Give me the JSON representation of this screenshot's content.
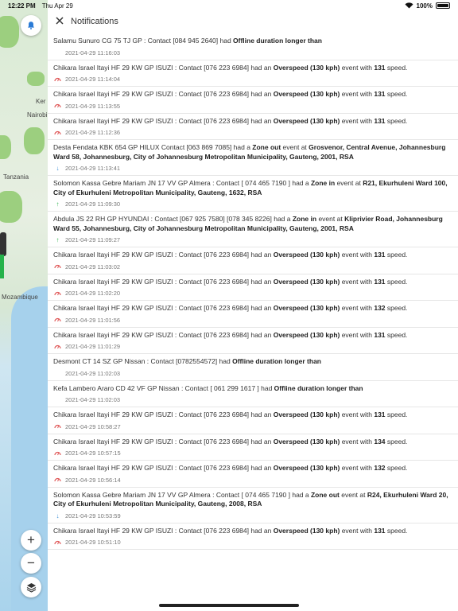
{
  "status_bar": {
    "time": "12:22 PM",
    "date": "Thu Apr 29",
    "battery": "100%"
  },
  "map": {
    "labels": [
      "Ker",
      "Nairobi",
      "Tanzania",
      "Mozambique"
    ],
    "zoom_in": "+",
    "zoom_out": "−"
  },
  "header": {
    "title": "Notifications"
  },
  "notifications": [
    {
      "type": "offline",
      "parts": [
        [
          "Salamu Sunuro CG 75 TJ GP : Contact [084 945 2640]",
          0
        ],
        [
          " had ",
          0
        ],
        [
          "Offline duration longer than",
          1
        ]
      ],
      "timestamp": "2021-04-29 11:16:03"
    },
    {
      "type": "speed",
      "parts": [
        [
          "Chikara Israel Itayi HF 29 KW GP ISUZI : Contact [076 223 6984]",
          0
        ],
        [
          " had an ",
          0
        ],
        [
          "Overspeed (130 kph)",
          1
        ],
        [
          " event with ",
          0
        ],
        [
          "131",
          1
        ],
        [
          " speed.",
          0
        ]
      ],
      "timestamp": "2021-04-29 11:14:04"
    },
    {
      "type": "speed",
      "parts": [
        [
          "Chikara Israel Itayi HF 29 KW GP ISUZI : Contact [076 223 6984]",
          0
        ],
        [
          " had an ",
          0
        ],
        [
          "Overspeed (130 kph)",
          1
        ],
        [
          " event with ",
          0
        ],
        [
          "131",
          1
        ],
        [
          " speed.",
          0
        ]
      ],
      "timestamp": "2021-04-29 11:13:55"
    },
    {
      "type": "speed",
      "parts": [
        [
          "Chikara Israel Itayi HF 29 KW GP ISUZI : Contact [076 223 6984]",
          0
        ],
        [
          " had an ",
          0
        ],
        [
          "Overspeed (130 kph)",
          1
        ],
        [
          " event with ",
          0
        ],
        [
          "131",
          1
        ],
        [
          " speed.",
          0
        ]
      ],
      "timestamp": "2021-04-29 11:12:36"
    },
    {
      "type": "zone_out",
      "parts": [
        [
          "Desta Fendata KBK 654 GP HILUX Contact [063 869 7085]",
          0
        ],
        [
          " had a ",
          0
        ],
        [
          "Zone out",
          1
        ],
        [
          " event at ",
          0
        ],
        [
          "Grosvenor, Central Avenue, Johannesburg Ward 58, Johannesburg, City of Johannesburg Metropolitan Municipality, Gauteng, 2001, RSA",
          1
        ]
      ],
      "timestamp": "2021-04-29 11:13:41"
    },
    {
      "type": "zone_in",
      "parts": [
        [
          "Solomon  Kassa Gebre Mariam JN 17 VV GP Almera : Contact [ 074 465 7190 ]",
          0
        ],
        [
          " had a ",
          0
        ],
        [
          "Zone in",
          1
        ],
        [
          " event at ",
          0
        ],
        [
          "R21, Ekurhuleni Ward 100, City of Ekurhuleni Metropolitan Municipality, Gauteng, 1632, RSA",
          1
        ]
      ],
      "timestamp": "2021-04-29 11:09:30"
    },
    {
      "type": "zone_in",
      "parts": [
        [
          "Abdula JS 22 RH GP HYUNDAI : Contact [067 925 7580] [078 345 8226]",
          0
        ],
        [
          " had a ",
          0
        ],
        [
          "Zone in",
          1
        ],
        [
          " event at ",
          0
        ],
        [
          "Kliprivier Road, Johannesburg Ward 55, Johannesburg, City of Johannesburg Metropolitan Municipality, Gauteng, 2001, RSA",
          1
        ]
      ],
      "timestamp": "2021-04-29 11:09:27"
    },
    {
      "type": "speed",
      "parts": [
        [
          "Chikara Israel Itayi HF 29 KW GP ISUZI : Contact [076 223 6984]",
          0
        ],
        [
          " had an ",
          0
        ],
        [
          "Overspeed (130 kph)",
          1
        ],
        [
          " event with ",
          0
        ],
        [
          "131",
          1
        ],
        [
          " speed.",
          0
        ]
      ],
      "timestamp": "2021-04-29 11:03:02"
    },
    {
      "type": "speed",
      "parts": [
        [
          "Chikara Israel Itayi HF 29 KW GP ISUZI : Contact [076 223 6984]",
          0
        ],
        [
          " had an ",
          0
        ],
        [
          "Overspeed (130 kph)",
          1
        ],
        [
          " event with ",
          0
        ],
        [
          "131",
          1
        ],
        [
          " speed.",
          0
        ]
      ],
      "timestamp": "2021-04-29 11:02:20"
    },
    {
      "type": "speed",
      "parts": [
        [
          "Chikara Israel Itayi HF 29 KW GP ISUZI : Contact [076 223 6984]",
          0
        ],
        [
          " had an ",
          0
        ],
        [
          "Overspeed (130 kph)",
          1
        ],
        [
          " event with ",
          0
        ],
        [
          "132",
          1
        ],
        [
          " speed.",
          0
        ]
      ],
      "timestamp": "2021-04-29 11:01:56"
    },
    {
      "type": "speed",
      "parts": [
        [
          "Chikara Israel Itayi HF 29 KW GP ISUZI : Contact [076 223 6984]",
          0
        ],
        [
          " had an ",
          0
        ],
        [
          "Overspeed (130 kph)",
          1
        ],
        [
          " event with ",
          0
        ],
        [
          "131",
          1
        ],
        [
          " speed.",
          0
        ]
      ],
      "timestamp": "2021-04-29 11:01:29"
    },
    {
      "type": "offline",
      "parts": [
        [
          "Desmont CT 14 SZ GP  Nissan : Contact [0782554572]",
          0
        ],
        [
          "  had ",
          0
        ],
        [
          "Offline duration longer than",
          1
        ]
      ],
      "timestamp": "2021-04-29 11:02:03"
    },
    {
      "type": "offline",
      "parts": [
        [
          "Kefa Lambero  Araro CD 42 VF GP  Nissan : Contact [ 061 299 1617 ]",
          0
        ],
        [
          " had ",
          0
        ],
        [
          "Offline duration longer than",
          1
        ]
      ],
      "timestamp": "2021-04-29 11:02:03"
    },
    {
      "type": "speed",
      "parts": [
        [
          "Chikara Israel Itayi HF 29 KW GP ISUZI : Contact [076 223 6984]",
          0
        ],
        [
          " had an ",
          0
        ],
        [
          "Overspeed (130 kph)",
          1
        ],
        [
          " event with ",
          0
        ],
        [
          "131",
          1
        ],
        [
          " speed.",
          0
        ]
      ],
      "timestamp": "2021-04-29 10:58:27"
    },
    {
      "type": "speed",
      "parts": [
        [
          "Chikara Israel Itayi HF 29 KW GP ISUZI : Contact [076 223 6984]",
          0
        ],
        [
          " had an ",
          0
        ],
        [
          "Overspeed (130 kph)",
          1
        ],
        [
          " event with ",
          0
        ],
        [
          "134",
          1
        ],
        [
          " speed.",
          0
        ]
      ],
      "timestamp": "2021-04-29 10:57:15"
    },
    {
      "type": "speed",
      "parts": [
        [
          "Chikara Israel Itayi HF 29 KW GP ISUZI : Contact [076 223 6984]",
          0
        ],
        [
          " had an ",
          0
        ],
        [
          "Overspeed (130 kph)",
          1
        ],
        [
          " event with ",
          0
        ],
        [
          "132",
          1
        ],
        [
          " speed.",
          0
        ]
      ],
      "timestamp": "2021-04-29 10:56:14"
    },
    {
      "type": "zone_out",
      "parts": [
        [
          "Solomon  Kassa Gebre Mariam JN 17 VV GP Almera : Contact [ 074 465 7190 ]",
          0
        ],
        [
          " had a ",
          0
        ],
        [
          "Zone out",
          1
        ],
        [
          " event at ",
          0
        ],
        [
          "R24, Ekurhuleni Ward 20, City of Ekurhuleni Metropolitan Municipality, Gauteng, 2008, RSA",
          1
        ]
      ],
      "timestamp": "2021-04-29 10:53:59"
    },
    {
      "type": "speed",
      "parts": [
        [
          "Chikara Israel Itayi HF 29 KW GP ISUZI : Contact [076 223 6984]",
          0
        ],
        [
          " had an ",
          0
        ],
        [
          "Overspeed (130 kph)",
          1
        ],
        [
          " event with ",
          0
        ],
        [
          "131",
          1
        ],
        [
          " speed.",
          0
        ]
      ],
      "timestamp": "2021-04-29 10:51:10"
    }
  ],
  "icon_colors": {
    "speed": "#e05a5a",
    "zone_out": "#3a8fd6",
    "zone_in": "#2fb14b"
  }
}
